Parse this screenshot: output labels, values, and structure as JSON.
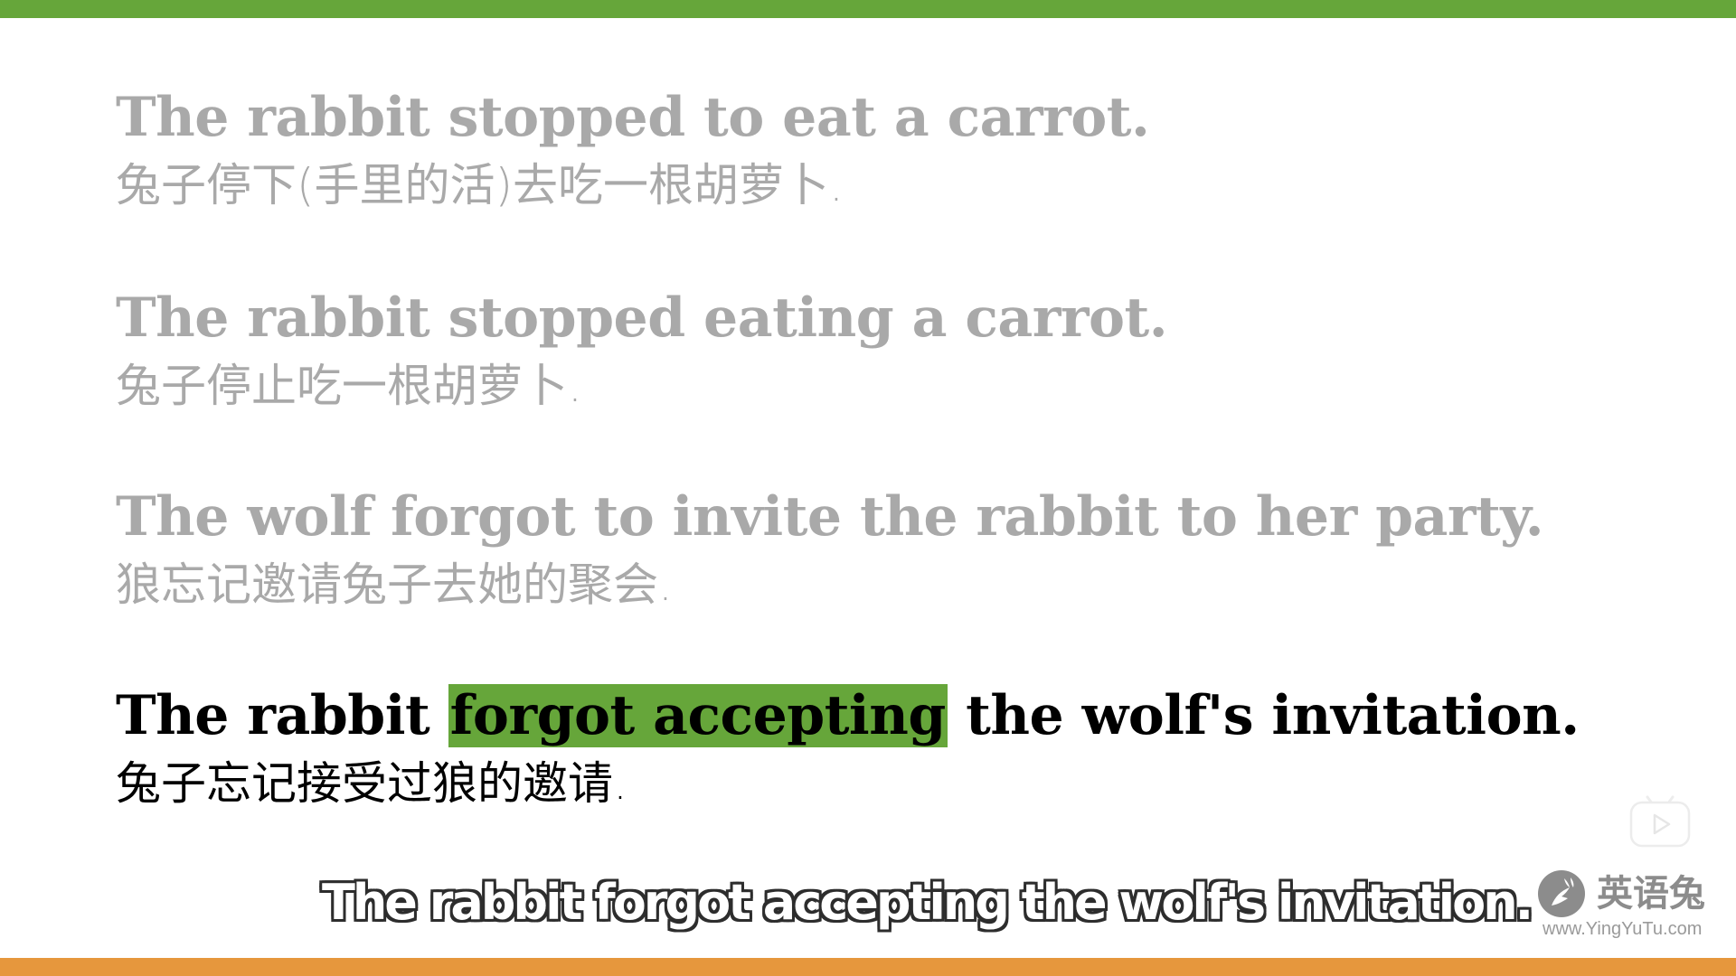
{
  "colors": {
    "top_bar": "#66a63a",
    "bottom_bar": "#e6973d",
    "highlight": "#66a63a",
    "dim_text": "#a9a9a9",
    "active_text": "#000000",
    "watermark": "#8c8c8c"
  },
  "sentences": [
    {
      "en": "The rabbit stopped to eat a carrot.",
      "zh": "兔子停下(手里的活)去吃一根胡萝卜."
    },
    {
      "en": "The rabbit stopped eating a carrot.",
      "zh": "兔子停止吃一根胡萝卜."
    },
    {
      "en": "The wolf forgot to invite the rabbit to her party.",
      "zh": "狼忘记邀请兔子去她的聚会."
    },
    {
      "en_before": "The rabbit ",
      "en_highlight": "forgot accepting",
      "en_after": " the wolf's invitation.",
      "zh": "兔子忘记接受过狼的邀请."
    }
  ],
  "subtitle": "The rabbit forgot accepting the wolf's invitation.",
  "watermark": {
    "name": "英语兔",
    "url": "www.YingYuTu.com",
    "logo_icon": "rabbit-logo-icon"
  },
  "controls": {
    "play_icon": "play-icon"
  }
}
